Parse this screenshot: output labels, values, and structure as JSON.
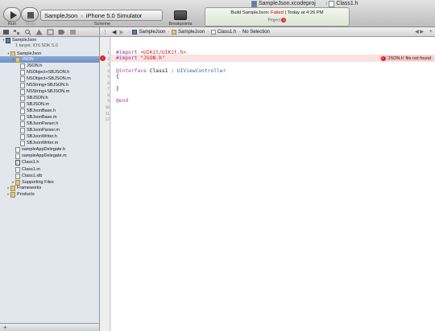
{
  "toolbar": {
    "run_label": "Run",
    "stop_label": "Stop",
    "scheme_label": "Scheme",
    "breakpoints_label": "Breakpoints",
    "scheme_target": "SampleJson",
    "scheme_destination": "iPhone 5.0 Simulator",
    "scheme_separator": "›"
  },
  "document_tabs": {
    "project": "SampleJson.xcodeproj",
    "file": "Class1.h"
  },
  "activity": {
    "build_prefix": "Build SampleJson:",
    "status": "Failed",
    "separator": "|",
    "time": "Today at 4:26 PM",
    "project_label": "Project",
    "error_count": "1"
  },
  "navigator": {
    "items": [
      {
        "label": "SampleJson",
        "kind": "proj",
        "indent": 0,
        "tri": "▾"
      },
      {
        "label": "1 target, iOS SDK 5.0",
        "kind": "none",
        "indent": 2,
        "tri": ""
      },
      {
        "label": "SampleJson",
        "kind": "folder",
        "indent": 1,
        "tri": "▾"
      },
      {
        "label": "JSON",
        "kind": "folder",
        "indent": 2,
        "tri": "▾",
        "selected": true
      },
      {
        "label": "JSON.h",
        "kind": "hdr",
        "indent": 3,
        "tri": ""
      },
      {
        "label": "NSObject+SBJSON.h",
        "kind": "hdr",
        "indent": 3,
        "tri": ""
      },
      {
        "label": "NSObject+SBJSON.m",
        "kind": "impl",
        "indent": 3,
        "tri": ""
      },
      {
        "label": "NSString+SBJSON.h",
        "kind": "hdr",
        "indent": 3,
        "tri": ""
      },
      {
        "label": "NSString+SBJSON.m",
        "kind": "impl",
        "indent": 3,
        "tri": ""
      },
      {
        "label": "SBJSON.h",
        "kind": "hdr",
        "indent": 3,
        "tri": ""
      },
      {
        "label": "SBJSON.m",
        "kind": "impl",
        "indent": 3,
        "tri": ""
      },
      {
        "label": "SBJsonBase.h",
        "kind": "hdr",
        "indent": 3,
        "tri": ""
      },
      {
        "label": "SBJsonBase.m",
        "kind": "impl",
        "indent": 3,
        "tri": ""
      },
      {
        "label": "SBJsonParser.h",
        "kind": "hdr",
        "indent": 3,
        "tri": ""
      },
      {
        "label": "SBJsonParser.m",
        "kind": "impl",
        "indent": 3,
        "tri": ""
      },
      {
        "label": "SBJsonWriter.h",
        "kind": "hdr",
        "indent": 3,
        "tri": ""
      },
      {
        "label": "SBJsonWriter.m",
        "kind": "impl",
        "indent": 3,
        "tri": ""
      },
      {
        "label": "sampleAppDelegate.h",
        "kind": "hdr",
        "indent": 2,
        "tri": ""
      },
      {
        "label": "sampleAppDelegate.m",
        "kind": "impl",
        "indent": 2,
        "tri": ""
      },
      {
        "label": "Class1.h",
        "kind": "sel-h",
        "indent": 2,
        "tri": ""
      },
      {
        "label": "Class1.m",
        "kind": "impl",
        "indent": 2,
        "tri": ""
      },
      {
        "label": "Class1.xib",
        "kind": "xib",
        "indent": 2,
        "tri": ""
      },
      {
        "label": "Supporting Files",
        "kind": "folder",
        "indent": 2,
        "tri": "▸"
      },
      {
        "label": "Frameworks",
        "kind": "folder",
        "indent": 1,
        "tri": "▸"
      },
      {
        "label": "Products",
        "kind": "folder",
        "indent": 1,
        "tri": "▸"
      }
    ]
  },
  "jumpbar": {
    "crumbs": [
      "SampleJson",
      "SampleJson",
      "Class1.h",
      "No Selection"
    ],
    "separator": "›"
  },
  "editor": {
    "line_numbers": [
      "1",
      "2",
      "3",
      "4",
      "5",
      "6",
      "7",
      "8",
      "9",
      "10",
      "11",
      "12"
    ],
    "lines": {
      "import1_kw": "#import",
      "import1_path": " <UIKit/UIKit.h>",
      "import2_kw": "#import",
      "import2_path": " \"JSON.h\"",
      "iface_kw": "@interface",
      "iface_name": " Class1 : ",
      "iface_super": "UIViewController",
      "brace_open": "{",
      "brace_close": "}",
      "end_kw": "@end"
    },
    "error": {
      "badge": "!",
      "message": "'JSON.h' file not found"
    }
  }
}
